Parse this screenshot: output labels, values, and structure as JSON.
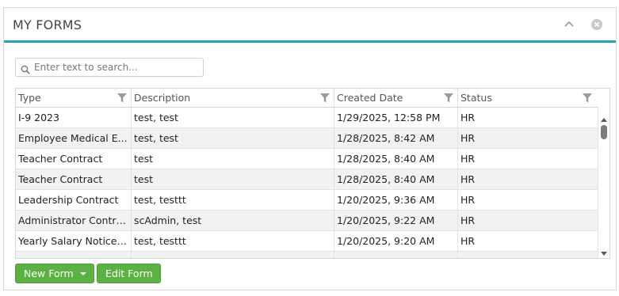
{
  "panel": {
    "title": "MY FORMS",
    "icons": [
      "chevron-up-icon",
      "close-circle-icon"
    ]
  },
  "search": {
    "placeholder": "Enter text to search...",
    "value": ""
  },
  "grid": {
    "columns": [
      {
        "label": "Type",
        "icon": "filter-icon"
      },
      {
        "label": "Description",
        "icon": "filter-icon"
      },
      {
        "label": "Created Date",
        "icon": "filter-icon"
      },
      {
        "label": "Status",
        "icon": "filter-icon"
      }
    ],
    "rows": [
      [
        "I-9 2023",
        "test, test",
        "1/29/2025, 12:58 PM",
        "HR"
      ],
      [
        "Employee Medical E...",
        "test, test",
        "1/28/2025, 8:42 AM",
        "HR"
      ],
      [
        "Teacher Contract",
        "test",
        "1/28/2025, 8:40 AM",
        "HR"
      ],
      [
        "Teacher Contract",
        "test",
        "1/28/2025, 8:40 AM",
        "HR"
      ],
      [
        "Leadership Contract",
        "test, testtt",
        "1/20/2025, 9:36 AM",
        "HR"
      ],
      [
        "Administrator Contra...",
        "scAdmin, test",
        "1/20/2025, 9:22 AM",
        "HR"
      ],
      [
        "Yearly Salary Notice ...",
        "test, testtt",
        "1/20/2025, 9:20 AM",
        "HR"
      ]
    ]
  },
  "buttons": {
    "new_form": "New Form",
    "edit_form": "Edit Form"
  },
  "colors": {
    "accent": "#2ba0b5",
    "button_green": "#5bb243",
    "row_alt": "#f2f2f2"
  }
}
